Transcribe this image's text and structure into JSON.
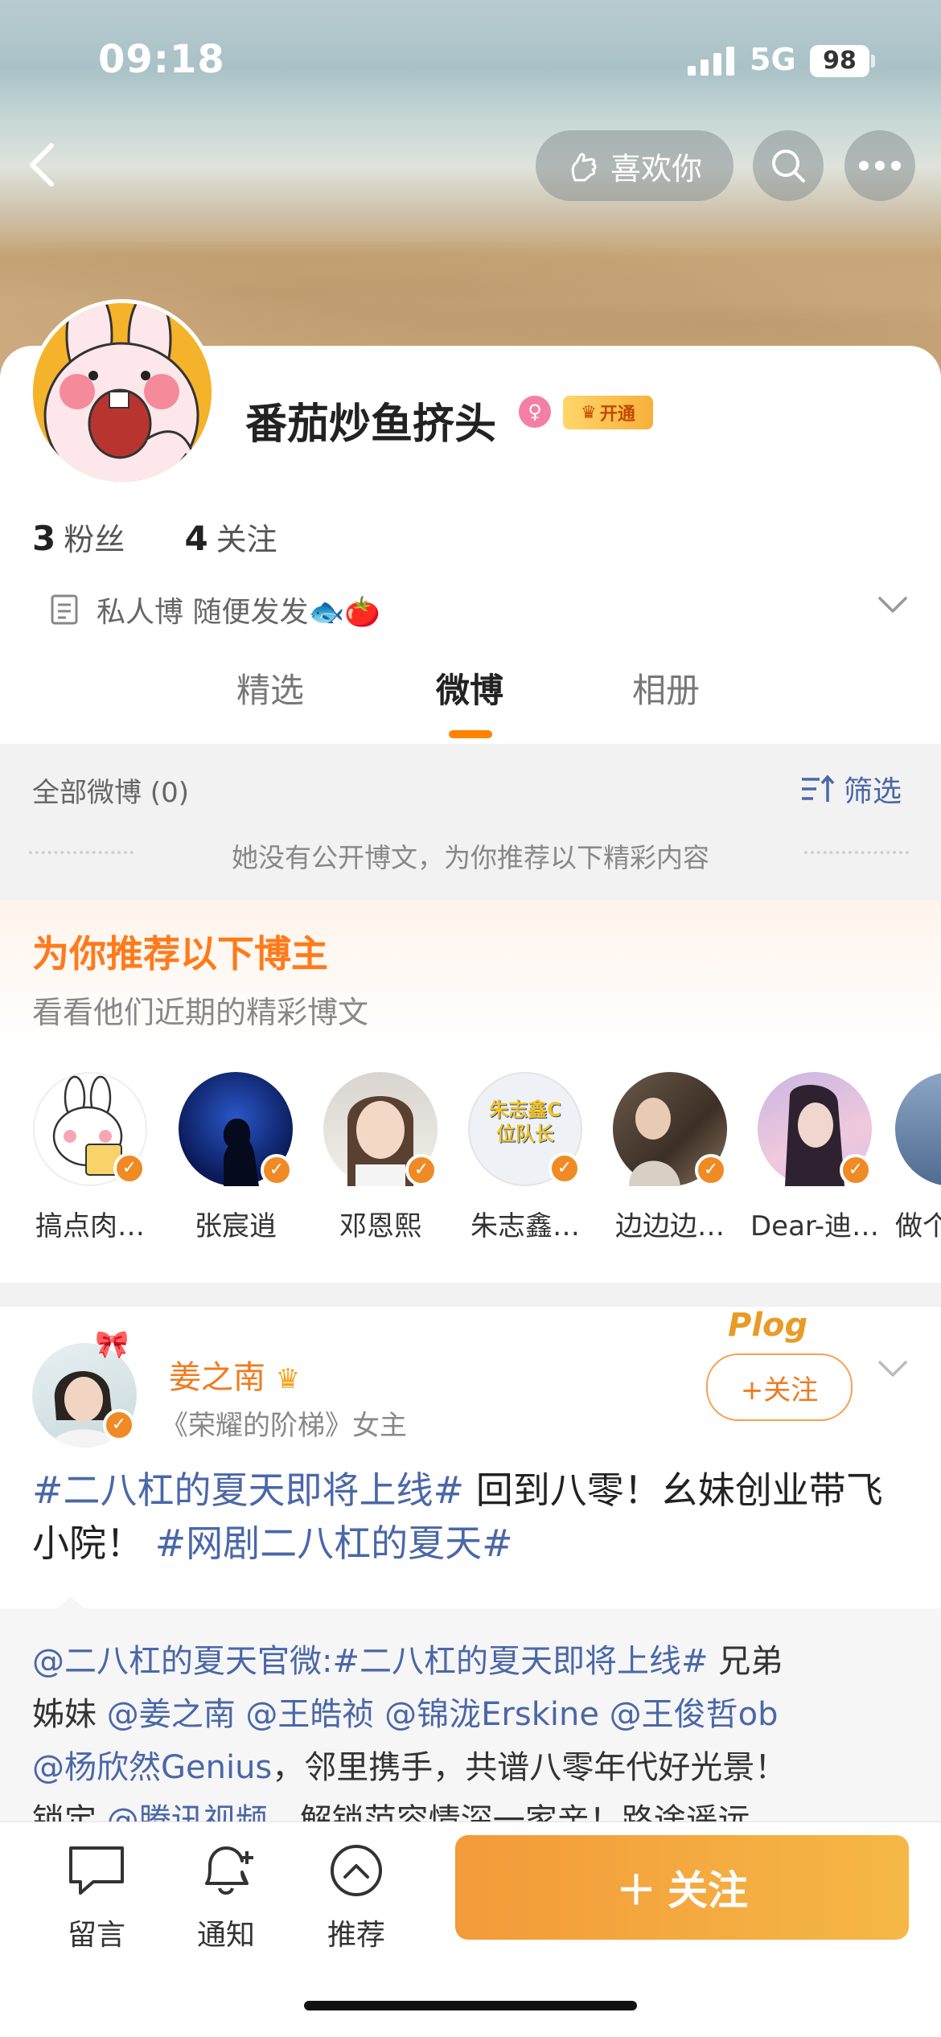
{
  "status": {
    "time": "09:18",
    "network": "5G",
    "battery": "98"
  },
  "header": {
    "like_label": "喜欢你"
  },
  "profile": {
    "name": "番茄炒鱼挤头",
    "vip_tag": "开通",
    "fans_count": "3",
    "fans_label": "粉丝",
    "follow_count": "4",
    "follow_label": "关注",
    "bio": "私人博 随便发发🐟🍅"
  },
  "tabs": [
    {
      "label": "精选"
    },
    {
      "label": "微博"
    },
    {
      "label": "相册"
    }
  ],
  "feed": {
    "all_label": "全部微博 (0)",
    "filter_label": "筛选",
    "empty_note": "她没有公开博文，为你推荐以下精彩内容"
  },
  "recommend": {
    "title": "为你推荐以下博主",
    "subtitle": "看看他们近期的精彩博文",
    "users": [
      {
        "name": "搞点肉…"
      },
      {
        "name": "张宸逍"
      },
      {
        "name": "邓恩熙"
      },
      {
        "name": "朱志鑫…",
        "avatar_text": "朱志鑫C位队长"
      },
      {
        "name": "边边边…"
      },
      {
        "name": "Dear-迪…"
      },
      {
        "name": "做个"
      }
    ]
  },
  "post": {
    "author": "姜之南",
    "author_desc": "《荣耀的阶梯》女主",
    "follow_label": "+关注",
    "plog_label": "Plog",
    "text": {
      "tag1": "#二八杠的夏天即将上线#",
      "body1": " 回到八零！幺妹创业带飞小院！",
      "tag2": "#网剧二八杠的夏天#"
    },
    "repost": {
      "line1_a": "@二八杠的夏天官微:#二八杠的夏天即将上线#",
      "line1_b": " 兄弟",
      "line2_a": "姊妹 ",
      "line2_b": "@姜之南 @王皓祯 @锦泷Erskine @王俊哲ob",
      "line3_a": "@杨欣然Genius",
      "line3_b": "，邻里携手，共谱八零年代好光景！",
      "line4_a": "锁定 ",
      "line4_b": "@腾讯视频",
      "line4_c": "，解锁范容情深一家亲！路途遥远"
    }
  },
  "bottom": {
    "comment_label": "留言",
    "notify_label": "通知",
    "recommend_label": "推荐",
    "follow_label": "关注"
  }
}
